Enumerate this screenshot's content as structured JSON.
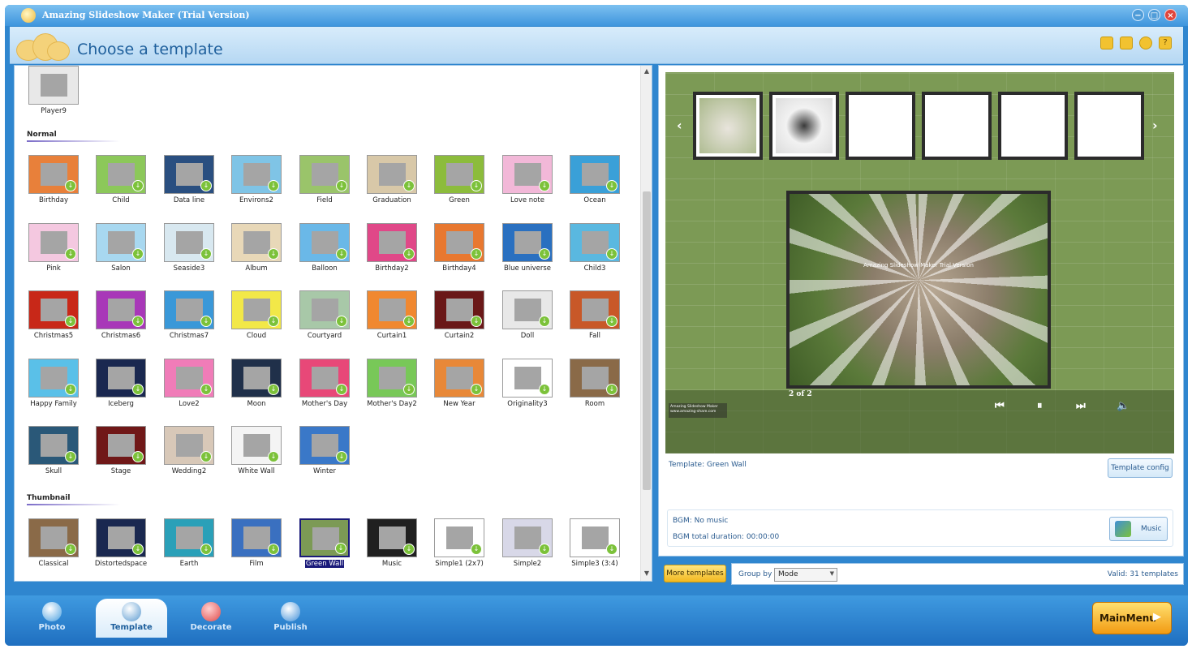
{
  "window": {
    "title": "Amazing Slideshow Maker (Trial Version)",
    "min_glyph": "−",
    "max_glyph": "□",
    "close_glyph": "×"
  },
  "header": {
    "title": "Choose a template",
    "icons": [
      "folder-icon",
      "save-icon",
      "tips-icon",
      "help-icon"
    ]
  },
  "sections": {
    "normal": "Normal",
    "thumbnail": "Thumbnail"
  },
  "templates": {
    "top": [
      "Player9"
    ],
    "normal": [
      "Birthday",
      "Child",
      "Data line",
      "Environs2",
      "Field",
      "Graduation",
      "Green",
      "Love note",
      "Ocean",
      "Pink",
      "Salon",
      "Seaside3",
      "Album",
      "Balloon",
      "Birthday2",
      "Birthday4",
      "Blue universe",
      "Child3",
      "Christmas5",
      "Christmas6",
      "Christmas7",
      "Cloud",
      "Courtyard",
      "Curtain1",
      "Curtain2",
      "Doll",
      "Fall",
      "Happy Family",
      "Iceberg",
      "Love2",
      "Moon",
      "Mother's Day",
      "Mother's Day2",
      "New Year",
      "Originality3",
      "Room",
      "Skull",
      "Stage",
      "Wedding2",
      "White Wall",
      "Winter"
    ],
    "thumbnail": [
      "Classical",
      "Distortedspace",
      "Earth",
      "Film",
      "Green Wall",
      "Music",
      "Simple1 (2x7)",
      "Simple2",
      "Simple3 (3:4)"
    ],
    "selected": "Green Wall"
  },
  "preview": {
    "counter": "2 of 2",
    "watermark": "Amazing Slideshow Maker Trial Version",
    "badge_text": "Amazing Slideshow Maker www.amazing-share.com",
    "controls": {
      "prev": "⏮",
      "pause": "⏸",
      "next": "⏭",
      "volume": "🔈"
    },
    "strip_left": "‹",
    "strip_right": "›"
  },
  "info": {
    "template_label": "Template:  Green Wall",
    "template_config": "Template config",
    "bgm": "BGM: No music",
    "bgm_duration": "BGM total duration: 00:00:00",
    "music_button": "Music"
  },
  "bottom": {
    "more_templates": "More templates",
    "group_by_label": "Group by",
    "group_by_value": "Mode",
    "valid": "Valid: 31 templates"
  },
  "nav": {
    "tabs": [
      "Photo",
      "Template",
      "Decorate",
      "Publish"
    ],
    "active": "Template",
    "main_menu": "MainMenu",
    "main_menu_arrow": "▶"
  },
  "colors": {
    "accent": "#2f86cf",
    "selected": "#1a1a7a",
    "preview_wall": "#7c9a55",
    "download_badge": "#7cc23a"
  }
}
